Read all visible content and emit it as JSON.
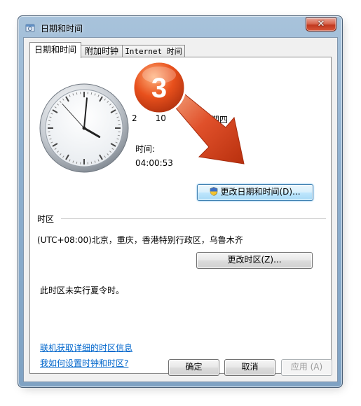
{
  "window": {
    "title": "日期和时间",
    "close_label": "✕"
  },
  "tabs": [
    {
      "label": "日期和时间"
    },
    {
      "label": "附加时钟"
    },
    {
      "label": "Internet 时间"
    }
  ],
  "datetime": {
    "date_partial": "2",
    "date_partial_2": "10",
    "weekday": "星期四",
    "time_label": "时间:",
    "time_value": "04:00:53",
    "change_button": "更改日期和时间(D)..."
  },
  "timezone": {
    "section_label": "时区",
    "value": "(UTC+08:00)北京，重庆，香港特别行政区，乌鲁木齐",
    "change_button": "更改时区(Z)...",
    "dst_note": "此时区未实行夏令时。"
  },
  "links": {
    "online_info": "联机获取详细的时区信息",
    "how_to": "我如何设置时钟和时区?"
  },
  "footer": {
    "ok": "确定",
    "cancel": "取消",
    "apply": "应用 (A)"
  },
  "overlay": {
    "step_number": "3"
  },
  "clock": {
    "hour": 4,
    "minute": 0,
    "second": 53
  },
  "colors": {
    "badge_orange": "#e8501c",
    "arrow_red": "#d63a12",
    "link_blue": "#0066cc",
    "focus_blue": "#3c7fb1"
  }
}
